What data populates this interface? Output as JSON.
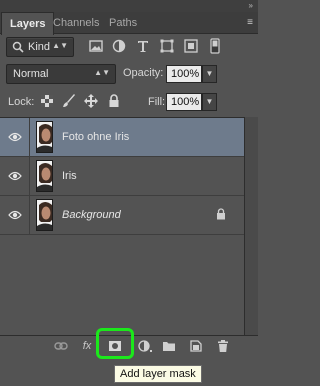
{
  "panel": {
    "tabs": [
      {
        "label": "Layers",
        "active": true
      },
      {
        "label": "Channels",
        "active": false
      },
      {
        "label": "Paths",
        "active": false
      }
    ],
    "collapse_glyph": "»",
    "menu_glyph": "≡"
  },
  "filter": {
    "kind_label": "Kind",
    "filter_icons": [
      "image-filter-icon",
      "adjustment-filter-icon",
      "type-filter-icon",
      "shape-filter-icon",
      "smart-object-filter-icon",
      "filter-toggle-icon"
    ]
  },
  "blend": {
    "mode": "Normal",
    "opacity_label": "Opacity:",
    "opacity_value": "100%"
  },
  "lock": {
    "label": "Lock:",
    "icons": [
      "lock-transparent-icon",
      "lock-image-icon",
      "lock-position-icon",
      "lock-all-icon"
    ],
    "fill_label": "Fill:",
    "fill_value": "100%"
  },
  "layers": [
    {
      "name": "Foto ohne Iris",
      "selected": true,
      "italic": false,
      "locked": false
    },
    {
      "name": "Iris",
      "selected": false,
      "italic": false,
      "locked": false
    },
    {
      "name": "Background",
      "selected": false,
      "italic": true,
      "locked": true
    }
  ],
  "toolbar": {
    "icons": [
      "link-layers-icon",
      "fx-icon",
      "add-layer-mask-icon",
      "adjustment-layer-icon",
      "new-group-icon",
      "new-layer-icon",
      "delete-layer-icon"
    ],
    "fx_glyph": "fx",
    "highlight_color": "#1be81b"
  },
  "tooltip": {
    "text": "Add layer mask"
  },
  "colors": {
    "panel_bg": "#535353",
    "selected_row": "#6e7b8c"
  }
}
